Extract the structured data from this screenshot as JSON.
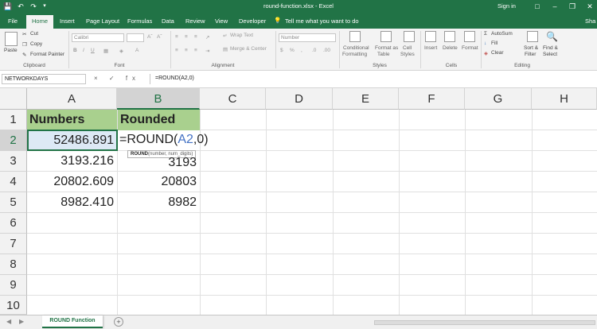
{
  "window": {
    "title": "round-function.xlsx - Excel",
    "signin": "Sign in",
    "qa_icons": [
      "save-icon",
      "undo-icon",
      "redo-icon",
      "customize-icon"
    ],
    "controls": [
      "ribbon-display-icon",
      "minimize-icon",
      "restore-icon",
      "close-icon"
    ]
  },
  "tabs": [
    "File",
    "Home",
    "Insert",
    "Page Layout",
    "Formulas",
    "Data",
    "Review",
    "View",
    "Developer"
  ],
  "active_tab": "Home",
  "tell_me": "Tell me what you want to do",
  "share": "Sha",
  "ribbon": {
    "paste": "Paste",
    "cut": "Cut",
    "copy": "Copy",
    "format_painter": "Format Painter",
    "clipboard_group": "Clipboard",
    "font_name": "Calibri",
    "font_group": "Font",
    "wrap_text": "Wrap Text",
    "merge_center": "Merge & Center",
    "alignment_group": "Alignment",
    "number_format": "Number",
    "conditional": "Conditional",
    "formatting": "Formatting",
    "format_as": "Format as",
    "table": "Table",
    "cell": "Cell",
    "styles_word": "Styles",
    "styles_group": "Styles",
    "insert": "Insert",
    "delete": "Delete",
    "format": "Format",
    "cells_group": "Cells",
    "autosum": "AutoSum",
    "fill": "Fill",
    "clear": "Clear",
    "sort_filter": "Sort &",
    "filter": "Filter",
    "find_select": "Find &",
    "select": "Select",
    "editing_group": "Editing"
  },
  "formula_bar": {
    "name_box": "NETWORKDAYS",
    "icons": "× ✓ fx",
    "content": "=ROUND(A2,0)"
  },
  "grid": {
    "columns": [
      "A",
      "B",
      "C",
      "D",
      "E",
      "F",
      "G",
      "H"
    ],
    "rows": [
      "1",
      "2",
      "3",
      "4",
      "5",
      "6",
      "7",
      "8",
      "9",
      "10"
    ],
    "header_a": "Numbers",
    "header_b": "Rounded",
    "a2": "52486.891",
    "a3": "3193.216",
    "a4": "20802.609",
    "a5": "8982.410",
    "b3": "3193",
    "b4": "20803",
    "b5": "8982",
    "edit_prefix": "=ROUND(",
    "edit_ref": "A2",
    "edit_suffix": ",0)",
    "tooltip_fn": "ROUND",
    "tooltip_args": "(number, num_digits)"
  },
  "sheet_tab": "ROUND Function",
  "add_sheet": "+"
}
